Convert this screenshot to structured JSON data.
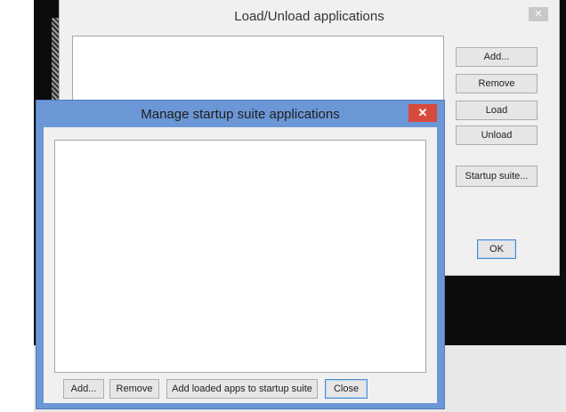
{
  "back_dialog": {
    "title": "Load/Unload applications",
    "close_glyph": "✕",
    "buttons": {
      "add": "Add...",
      "remove": "Remove",
      "load": "Load",
      "unload": "Unload",
      "startup_suite": "Startup suite...",
      "ok": "OK"
    }
  },
  "front_dialog": {
    "title": "Manage startup suite applications",
    "close_glyph": "✕",
    "buttons": {
      "add": "Add...",
      "remove": "Remove",
      "add_loaded": "Add loaded apps to startup suite",
      "close": "Close"
    }
  },
  "colors": {
    "front_frame": "#6b97d6",
    "close_red": "#d84b3b"
  }
}
